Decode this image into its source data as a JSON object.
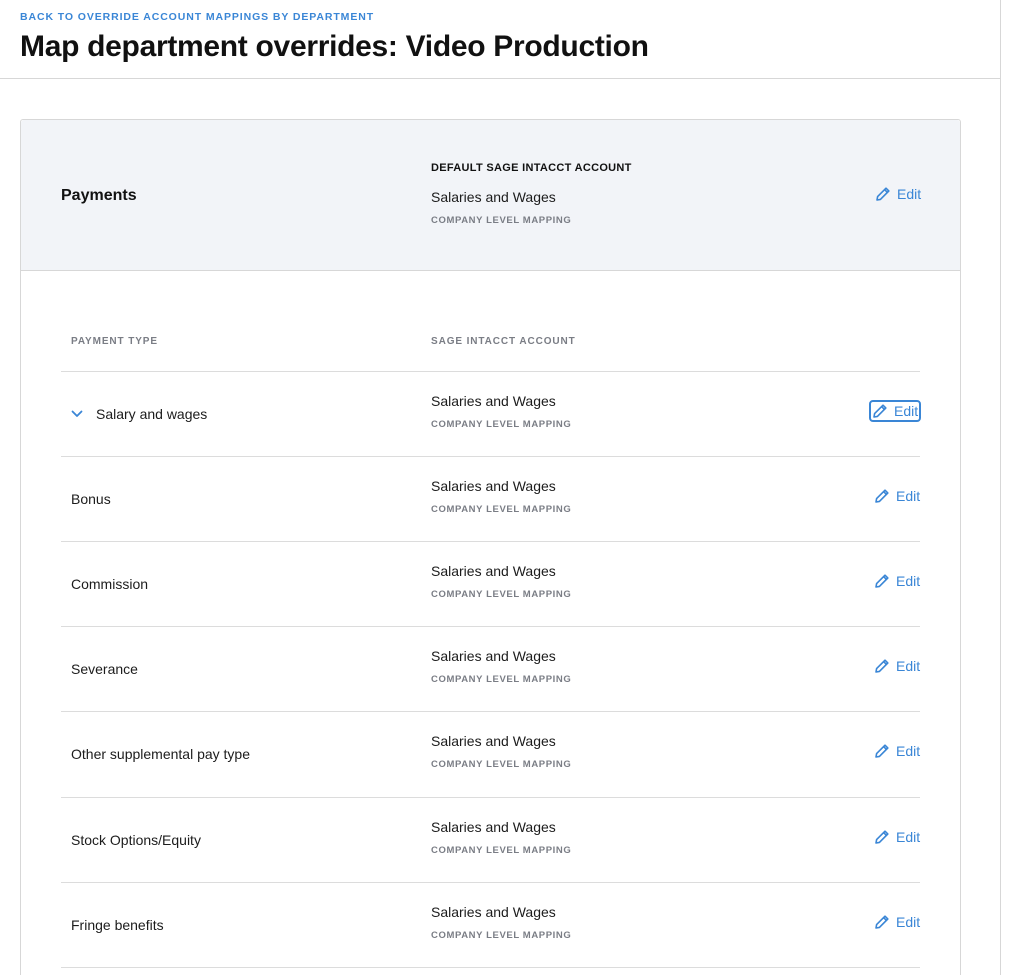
{
  "header": {
    "back_link": "BACK TO OVERRIDE ACCOUNT MAPPINGS BY DEPARTMENT",
    "title": "Map department overrides: Video Production"
  },
  "section": {
    "title": "Payments",
    "default_label": "DEFAULT SAGE INTACCT ACCOUNT",
    "default_value": "Salaries and Wages",
    "default_sub": "COMPANY LEVEL MAPPING",
    "edit_label": "Edit"
  },
  "table": {
    "col_payment_type": "PAYMENT TYPE",
    "col_account": "SAGE INTACCT ACCOUNT",
    "rows": [
      {
        "type": "Salary and wages",
        "account": "Salaries and Wages",
        "sub": "COMPANY LEVEL MAPPING",
        "edit": "Edit"
      },
      {
        "type": "Bonus",
        "account": "Salaries and Wages",
        "sub": "COMPANY LEVEL MAPPING",
        "edit": "Edit"
      },
      {
        "type": "Commission",
        "account": "Salaries and Wages",
        "sub": "COMPANY LEVEL MAPPING",
        "edit": "Edit"
      },
      {
        "type": "Severance",
        "account": "Salaries and Wages",
        "sub": "COMPANY LEVEL MAPPING",
        "edit": "Edit"
      },
      {
        "type": "Other supplemental pay type",
        "account": "Salaries and Wages",
        "sub": "COMPANY LEVEL MAPPING",
        "edit": "Edit"
      },
      {
        "type": "Stock Options/Equity",
        "account": "Salaries and Wages",
        "sub": "COMPANY LEVEL MAPPING",
        "edit": "Edit"
      },
      {
        "type": "Fringe benefits",
        "account": "Salaries and Wages",
        "sub": "COMPANY LEVEL MAPPING",
        "edit": "Edit"
      }
    ]
  },
  "icons": {
    "edit": "pencil-icon",
    "expand": "chevron-down-icon"
  },
  "colors": {
    "accent": "#3a86d6",
    "header_bg": "#f2f4f8",
    "muted_text": "#7a7d85",
    "border": "#d7d7d7"
  }
}
